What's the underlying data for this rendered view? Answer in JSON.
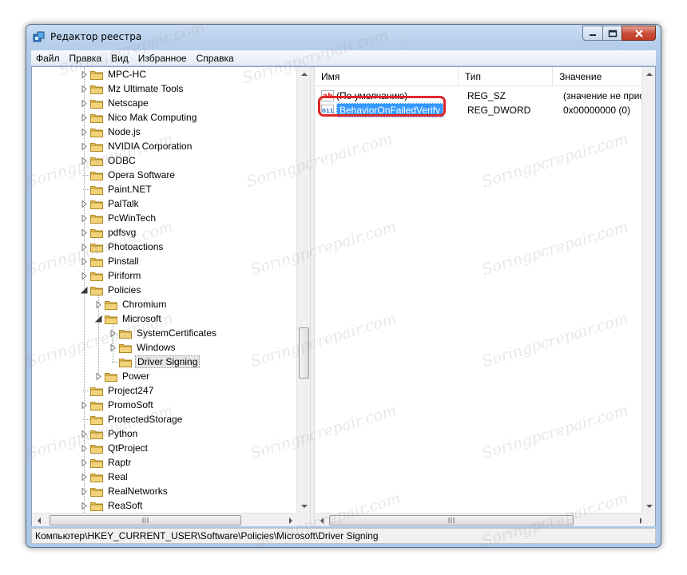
{
  "window": {
    "title": "Редактор реестра"
  },
  "menu": [
    "Файл",
    "Правка",
    "Вид",
    "Избранное",
    "Справка"
  ],
  "tree": {
    "items": [
      {
        "label": "MPC-HC",
        "expander": "collapsed",
        "level": 0
      },
      {
        "label": "Mz Ultimate Tools",
        "expander": "collapsed",
        "level": 0
      },
      {
        "label": "Netscape",
        "expander": "collapsed",
        "level": 0
      },
      {
        "label": "Nico Mak Computing",
        "expander": "collapsed",
        "level": 0
      },
      {
        "label": "Node.js",
        "expander": "collapsed",
        "level": 0
      },
      {
        "label": "NVIDIA Corporation",
        "expander": "collapsed",
        "level": 0
      },
      {
        "label": "ODBC",
        "expander": "collapsed",
        "level": 0
      },
      {
        "label": "Opera Software",
        "expander": "none",
        "level": 0
      },
      {
        "label": "Paint.NET",
        "expander": "none",
        "level": 0
      },
      {
        "label": "PalTalk",
        "expander": "collapsed",
        "level": 0
      },
      {
        "label": "PcWinTech",
        "expander": "collapsed",
        "level": 0
      },
      {
        "label": "pdfsvg",
        "expander": "collapsed",
        "level": 0
      },
      {
        "label": "Photoactions",
        "expander": "collapsed",
        "level": 0
      },
      {
        "label": "Pinstall",
        "expander": "collapsed",
        "level": 0
      },
      {
        "label": "Piriform",
        "expander": "collapsed",
        "level": 0
      },
      {
        "label": "Policies",
        "expander": "expanded",
        "level": 0
      },
      {
        "label": "Chromium",
        "expander": "collapsed",
        "level": 1
      },
      {
        "label": "Microsoft",
        "expander": "expanded",
        "level": 1
      },
      {
        "label": "SystemCertificates",
        "expander": "collapsed",
        "level": 2
      },
      {
        "label": "Windows",
        "expander": "collapsed",
        "level": 2
      },
      {
        "label": "Driver Signing",
        "expander": "none",
        "level": 2,
        "selected": true
      },
      {
        "label": "Power",
        "expander": "collapsed",
        "level": 1
      },
      {
        "label": "Project247",
        "expander": "none",
        "level": 0
      },
      {
        "label": "PromoSoft",
        "expander": "collapsed",
        "level": 0
      },
      {
        "label": "ProtectedStorage",
        "expander": "none",
        "level": 0
      },
      {
        "label": "Python",
        "expander": "collapsed",
        "level": 0
      },
      {
        "label": "QtProject",
        "expander": "collapsed",
        "level": 0
      },
      {
        "label": "Raptr",
        "expander": "collapsed",
        "level": 0
      },
      {
        "label": "Real",
        "expander": "collapsed",
        "level": 0
      },
      {
        "label": "RealNetworks",
        "expander": "collapsed",
        "level": 0
      },
      {
        "label": "ReaSoft",
        "expander": "collapsed",
        "level": 0
      }
    ]
  },
  "list": {
    "columns": {
      "name": "Имя",
      "type": "Тип",
      "value": "Значение"
    },
    "rows": [
      {
        "icon": "string-value-icon",
        "name": "(По умолчанию)",
        "type": "REG_SZ",
        "value": "(значение не присво"
      },
      {
        "icon": "dword-value-icon",
        "name": "BehaviorOnFailedVerify",
        "type": "REG_DWORD",
        "value": "0x00000000 (0)",
        "selected": true
      }
    ]
  },
  "statusbar": {
    "path": "Компьютер\\HKEY_CURRENT_USER\\Software\\Policies\\Microsoft\\Driver Signing"
  },
  "watermark": "Soringpcrepair.com",
  "colors": {
    "selection": "#3399ff",
    "highlight_ring": "#e0262a",
    "folder": "#e8c15a"
  }
}
